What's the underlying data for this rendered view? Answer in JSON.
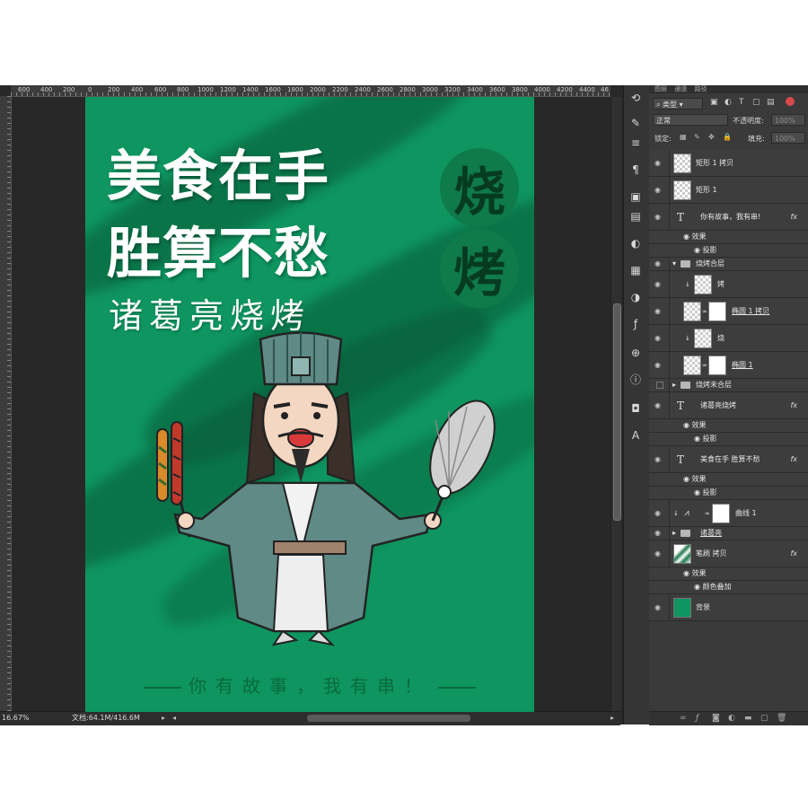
{
  "ruler": {
    "top_labels": [
      "600",
      "400",
      "200",
      "0",
      "200",
      "400",
      "600",
      "800",
      "1000",
      "1200",
      "1400",
      "1600",
      "1800",
      "2000",
      "2200",
      "2400",
      "2600",
      "2800",
      "3000",
      "3200",
      "3400",
      "3600",
      "3800",
      "4000",
      "4200",
      "4400",
      "46"
    ]
  },
  "status": {
    "zoom": "16.67%",
    "doc": "文档:64.1M/416.6M"
  },
  "canvas": {
    "headline_1": "美食在手",
    "headline_2": "胜算不愁",
    "subtitle": "诸葛亮烧烤",
    "seal_1": "烧",
    "seal_2": "烤",
    "slogan": "你有故事，我有串！",
    "colors": {
      "background": "#0e9560",
      "seal": "#0f7a4a",
      "robe": "#5f8a86"
    }
  },
  "panel": {
    "tabs": [
      "图层",
      "通道",
      "路径"
    ],
    "filter_kind": "类型",
    "blend_mode": "正常",
    "opacity_label": "不透明度:",
    "opacity_value": "100%",
    "lock_label": "锁定:",
    "fill_label": "填充:",
    "fill_value": "100%",
    "layers": [
      {
        "name": "矩形 1 拷贝",
        "kind": "image"
      },
      {
        "name": "矩形 1",
        "kind": "image"
      },
      {
        "name": "你有故事，我有串!",
        "kind": "text",
        "fx": "fx"
      },
      {
        "name": "效果",
        "kind": "effect-header"
      },
      {
        "name": "投影",
        "kind": "effect"
      },
      {
        "name": "烧烤合层",
        "kind": "group-open"
      },
      {
        "name": "烤",
        "kind": "clipped"
      },
      {
        "name": "椭圆 1 拷贝",
        "kind": "masked"
      },
      {
        "name": "烧",
        "kind": "clipped"
      },
      {
        "name": "椭圆 1",
        "kind": "masked"
      },
      {
        "name": "烧烤未合层",
        "kind": "group"
      },
      {
        "name": "诸葛亮烧烤",
        "kind": "text",
        "fx": "fx"
      },
      {
        "name": "效果",
        "kind": "effect-header"
      },
      {
        "name": "投影",
        "kind": "effect"
      },
      {
        "name": "美食在手 胜算不愁",
        "kind": "text",
        "fx": "fx"
      },
      {
        "name": "效果",
        "kind": "effect-header"
      },
      {
        "name": "投影",
        "kind": "effect"
      },
      {
        "name": "曲线 1",
        "kind": "adjustment"
      },
      {
        "name": "诸葛亮",
        "kind": "group"
      },
      {
        "name": "笔刷 拷贝",
        "kind": "image-green",
        "fx": "fx"
      },
      {
        "name": "效果",
        "kind": "effect-header"
      },
      {
        "name": "颜色叠加",
        "kind": "effect"
      },
      {
        "name": "背景",
        "kind": "background"
      }
    ]
  }
}
